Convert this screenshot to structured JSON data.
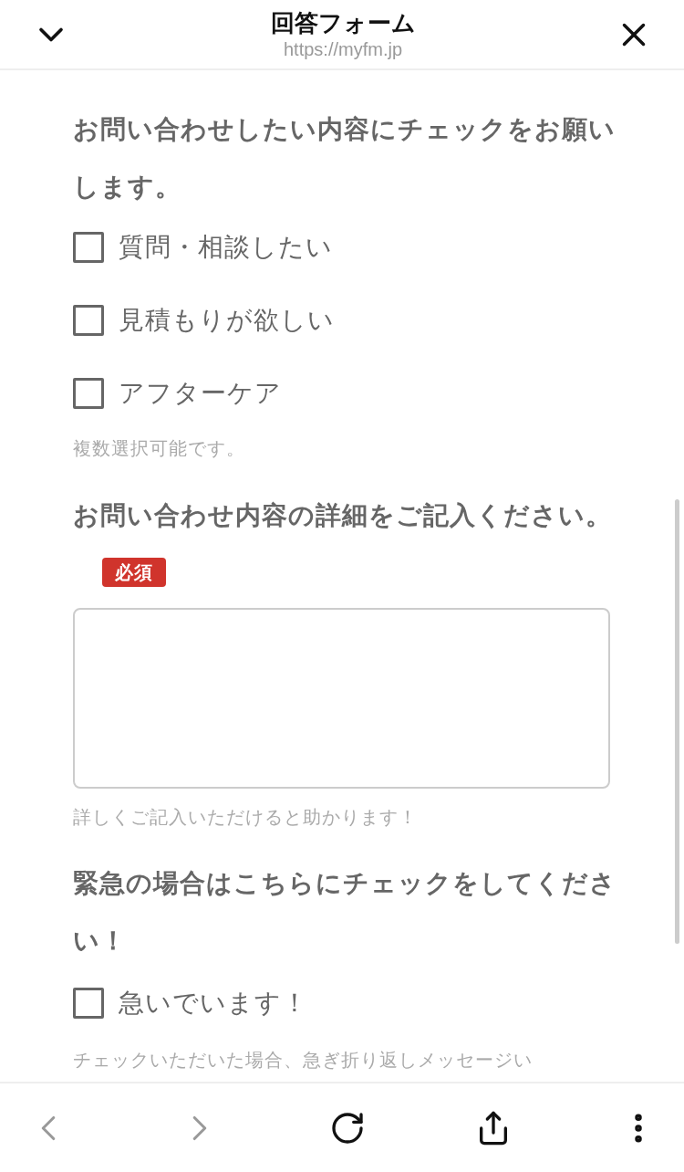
{
  "header": {
    "title": "回答フォーム",
    "url": "https://myfm.jp"
  },
  "questions": [
    {
      "kind": "checkboxes",
      "title": "お問い合わせしたい内容にチェックをお願いします。",
      "options": [
        {
          "label": "質問・相談したい",
          "checked": false
        },
        {
          "label": "見積もりが欲しい",
          "checked": false
        },
        {
          "label": "アフターケア",
          "checked": false
        }
      ],
      "note": "複数選択可能です。"
    },
    {
      "kind": "textarea",
      "title": "お問い合わせ内容の詳細をご記入ください。",
      "badge": "必須",
      "note": "詳しくご記入いただけると助かります！"
    },
    {
      "kind": "checkboxes",
      "title": "緊急の場合はこちらにチェックをしてください！",
      "options": [
        {
          "label": "急いでいます！",
          "checked": false
        }
      ],
      "note": "チェックいただいた場合、急ぎ折り返しメッセージい"
    }
  ]
}
